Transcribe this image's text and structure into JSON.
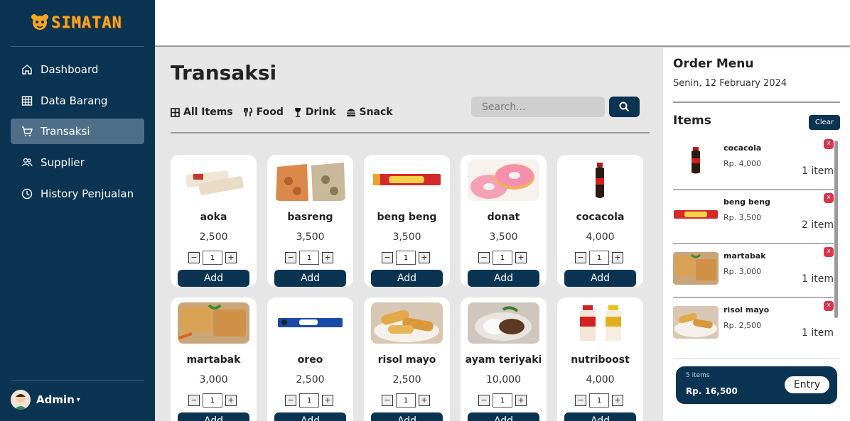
{
  "app": {
    "brand": "SIMATAN",
    "logo_icon": "tiger-mascot-icon"
  },
  "sidebar": {
    "items": [
      {
        "label": "Dashboard",
        "icon": "home-icon"
      },
      {
        "label": "Data Barang",
        "icon": "table-icon"
      },
      {
        "label": "Transaksi",
        "icon": "cart-icon",
        "active": true
      },
      {
        "label": "Supplier",
        "icon": "users-icon"
      },
      {
        "label": "History Penjualan",
        "icon": "clock-icon"
      }
    ],
    "user": {
      "name": "Admin",
      "caret": "▾"
    }
  },
  "main": {
    "title": "Transaksi",
    "filters": [
      {
        "label": "All Items",
        "icon": "grid-icon"
      },
      {
        "label": "Food",
        "icon": "utensils-icon"
      },
      {
        "label": "Drink",
        "icon": "wine-glass-icon"
      },
      {
        "label": "Snack",
        "icon": "burger-icon"
      }
    ],
    "search": {
      "placeholder": "Search..."
    },
    "add_label": "Add",
    "products": [
      {
        "name": "aoka",
        "price": "2,500",
        "qty": "1"
      },
      {
        "name": "basreng",
        "price": "3,500",
        "qty": "1"
      },
      {
        "name": "beng beng",
        "price": "3,500",
        "qty": "1"
      },
      {
        "name": "donat",
        "price": "3,500",
        "qty": "1"
      },
      {
        "name": "cocacola",
        "price": "4,000",
        "qty": "1"
      },
      {
        "name": "martabak",
        "price": "3,000",
        "qty": "1"
      },
      {
        "name": "oreo",
        "price": "2,500",
        "qty": "1"
      },
      {
        "name": "risol mayo",
        "price": "2,500",
        "qty": "1"
      },
      {
        "name": "ayam teriyaki",
        "price": "10,000",
        "qty": "1"
      },
      {
        "name": "nutriboost",
        "price": "4,000",
        "qty": "1"
      }
    ]
  },
  "order": {
    "title": "Order Menu",
    "date": "Senin, 12 February 2024",
    "items_title": "Items",
    "clear_label": "Clear",
    "items": [
      {
        "name": "cocacola",
        "price": "Rp. 4,000",
        "qty": "1 item"
      },
      {
        "name": "beng beng",
        "price": "Rp. 3,500",
        "qty": "2 item"
      },
      {
        "name": "martabak",
        "price": "Rp. 3,000",
        "qty": "1 item"
      },
      {
        "name": "risol mayo",
        "price": "Rp. 2,500",
        "qty": "1 item"
      }
    ],
    "remove_label": "x",
    "summary": {
      "count": "5 items",
      "total": "Rp. 16,500",
      "entry_label": "Entry"
    }
  },
  "colors": {
    "navy": "#0b3352",
    "active_nav": "#4f6e88",
    "remove_red": "#d9364a",
    "logo_orange": "#f5a623"
  }
}
